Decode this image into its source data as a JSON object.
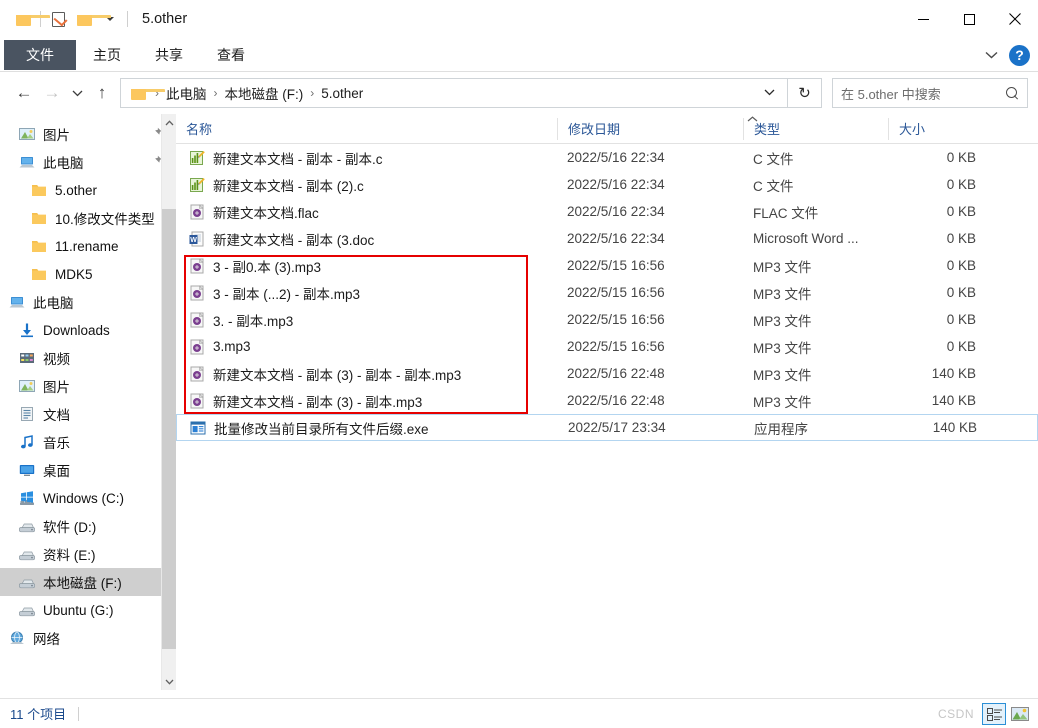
{
  "window": {
    "title": "5.other",
    "quick_access": [
      {
        "name": "folder-icon",
        "label": ""
      },
      {
        "name": "properties-icon",
        "label": ""
      },
      {
        "name": "new-folder-icon",
        "label": ""
      },
      {
        "name": "customize-caret-icon",
        "label": ""
      }
    ],
    "controls": {
      "minimize": "─",
      "maximize": "☐",
      "close": "✕"
    }
  },
  "ribbon": {
    "tabs": [
      {
        "label": "文件",
        "active": true
      },
      {
        "label": "主页",
        "active": false
      },
      {
        "label": "共享",
        "active": false
      },
      {
        "label": "查看",
        "active": false
      }
    ],
    "collapse_icon": "chevron-down-icon",
    "help_label": "?"
  },
  "address": {
    "back_icon": "←",
    "forward_icon": "→",
    "recent_icon": "⌄",
    "up_icon": "↑",
    "crumbs": [
      "此电脑",
      "本地磁盘 (F:)",
      "5.other"
    ],
    "separator": "›",
    "dropdown_icon": "⌄",
    "refresh_icon": "↻"
  },
  "search": {
    "placeholder": "在 5.other 中搜索",
    "icon": "search-icon"
  },
  "sidebar": {
    "items": [
      {
        "label": "图片",
        "icon": "pictures-icon",
        "indent": 1,
        "pinned": true,
        "selected": false
      },
      {
        "label": "此电脑",
        "icon": "computer-icon",
        "indent": 1,
        "pinned": true,
        "selected": false
      },
      {
        "label": "5.other",
        "icon": "folder-icon",
        "indent": 2,
        "pinned": false,
        "selected": false
      },
      {
        "label": "10.修改文件类型",
        "icon": "folder-icon",
        "indent": 2,
        "pinned": false,
        "selected": false
      },
      {
        "label": "11.rename",
        "icon": "folder-icon",
        "indent": 2,
        "pinned": false,
        "selected": false
      },
      {
        "label": "MDK5",
        "icon": "folder-icon",
        "indent": 2,
        "pinned": false,
        "selected": false
      },
      {
        "label": "此电脑",
        "icon": "computer-icon",
        "indent": 0,
        "pinned": false,
        "selected": false
      },
      {
        "label": "Downloads",
        "icon": "downloads-icon",
        "indent": 1,
        "pinned": false,
        "selected": false
      },
      {
        "label": "视频",
        "icon": "videos-icon",
        "indent": 1,
        "pinned": false,
        "selected": false
      },
      {
        "label": "图片",
        "icon": "pictures-icon",
        "indent": 1,
        "pinned": false,
        "selected": false
      },
      {
        "label": "文档",
        "icon": "documents-icon",
        "indent": 1,
        "pinned": false,
        "selected": false
      },
      {
        "label": "音乐",
        "icon": "music-icon",
        "indent": 1,
        "pinned": false,
        "selected": false
      },
      {
        "label": "桌面",
        "icon": "desktop-icon",
        "indent": 1,
        "pinned": false,
        "selected": false
      },
      {
        "label": "Windows (C:)",
        "icon": "windows-drive-icon",
        "indent": 1,
        "pinned": false,
        "selected": false
      },
      {
        "label": "软件 (D:)",
        "icon": "drive-icon",
        "indent": 1,
        "pinned": false,
        "selected": false
      },
      {
        "label": "资料 (E:)",
        "icon": "drive-icon",
        "indent": 1,
        "pinned": false,
        "selected": false
      },
      {
        "label": "本地磁盘 (F:)",
        "icon": "drive-icon",
        "indent": 1,
        "pinned": false,
        "selected": true
      },
      {
        "label": "Ubuntu (G:)",
        "icon": "drive-icon",
        "indent": 1,
        "pinned": false,
        "selected": false
      },
      {
        "label": "网络",
        "icon": "network-icon",
        "indent": 0,
        "pinned": false,
        "selected": false
      }
    ],
    "scroll_up_icon": "⌃",
    "scroll_down_icon": "⌄"
  },
  "columns": {
    "name": "名称",
    "date": "修改日期",
    "type": "类型",
    "size": "大小",
    "sort_indicator": "⌃",
    "sorted_by": "类型"
  },
  "files": [
    {
      "name": "新建文本文档 - 副本 - 副本.c",
      "date": "2022/5/16 22:34",
      "type": "C 文件",
      "size": "0 KB",
      "icon": "c-file-icon",
      "highlighted": false,
      "selected": false
    },
    {
      "name": "新建文本文档 - 副本 (2).c",
      "date": "2022/5/16 22:34",
      "type": "C 文件",
      "size": "0 KB",
      "icon": "c-file-icon",
      "highlighted": false,
      "selected": false
    },
    {
      "name": "新建文本文档.flac",
      "date": "2022/5/16 22:34",
      "type": "FLAC 文件",
      "size": "0 KB",
      "icon": "audio-file-icon",
      "highlighted": false,
      "selected": false
    },
    {
      "name": "新建文本文档 - 副本 (3.doc",
      "date": "2022/5/16 22:34",
      "type": "Microsoft Word ...",
      "size": "0 KB",
      "icon": "word-file-icon",
      "highlighted": false,
      "selected": false
    },
    {
      "name": "3 - 副0.本 (3).mp3",
      "date": "2022/5/15 16:56",
      "type": "MP3 文件",
      "size": "0 KB",
      "icon": "audio-file-icon",
      "highlighted": true,
      "selected": false
    },
    {
      "name": "3 - 副本 (...2) - 副本.mp3",
      "date": "2022/5/15 16:56",
      "type": "MP3 文件",
      "size": "0 KB",
      "icon": "audio-file-icon",
      "highlighted": true,
      "selected": false
    },
    {
      "name": "3. - 副本.mp3",
      "date": "2022/5/15 16:56",
      "type": "MP3 文件",
      "size": "0 KB",
      "icon": "audio-file-icon",
      "highlighted": true,
      "selected": false
    },
    {
      "name": "3.mp3",
      "date": "2022/5/15 16:56",
      "type": "MP3 文件",
      "size": "0 KB",
      "icon": "audio-file-icon",
      "highlighted": true,
      "selected": false
    },
    {
      "name": "新建文本文档 - 副本 (3) - 副本 - 副本.mp3",
      "date": "2022/5/16 22:48",
      "type": "MP3 文件",
      "size": "140 KB",
      "icon": "audio-file-icon",
      "highlighted": true,
      "selected": false
    },
    {
      "name": "新建文本文档 - 副本 (3) - 副本.mp3",
      "date": "2022/5/16 22:48",
      "type": "MP3 文件",
      "size": "140 KB",
      "icon": "audio-file-icon",
      "highlighted": true,
      "selected": false
    },
    {
      "name": "批量修改当前目录所有文件后缀.exe",
      "date": "2022/5/17 23:34",
      "type": "应用程序",
      "size": "140 KB",
      "icon": "exe-file-icon",
      "highlighted": false,
      "selected": true
    }
  ],
  "status": {
    "item_count": "11 个项目",
    "watermark": "CSDN",
    "views": [
      {
        "name": "details-view-button",
        "active": true
      },
      {
        "name": "large-icons-view-button",
        "active": false
      }
    ]
  },
  "colors": {
    "accent_blue": "#2b5797",
    "file_tab_bg": "#4a5461",
    "highlight_red": "#e60000",
    "selection_blue": "#b3d5f0",
    "sidebar_selected": "#cfcfcf"
  }
}
